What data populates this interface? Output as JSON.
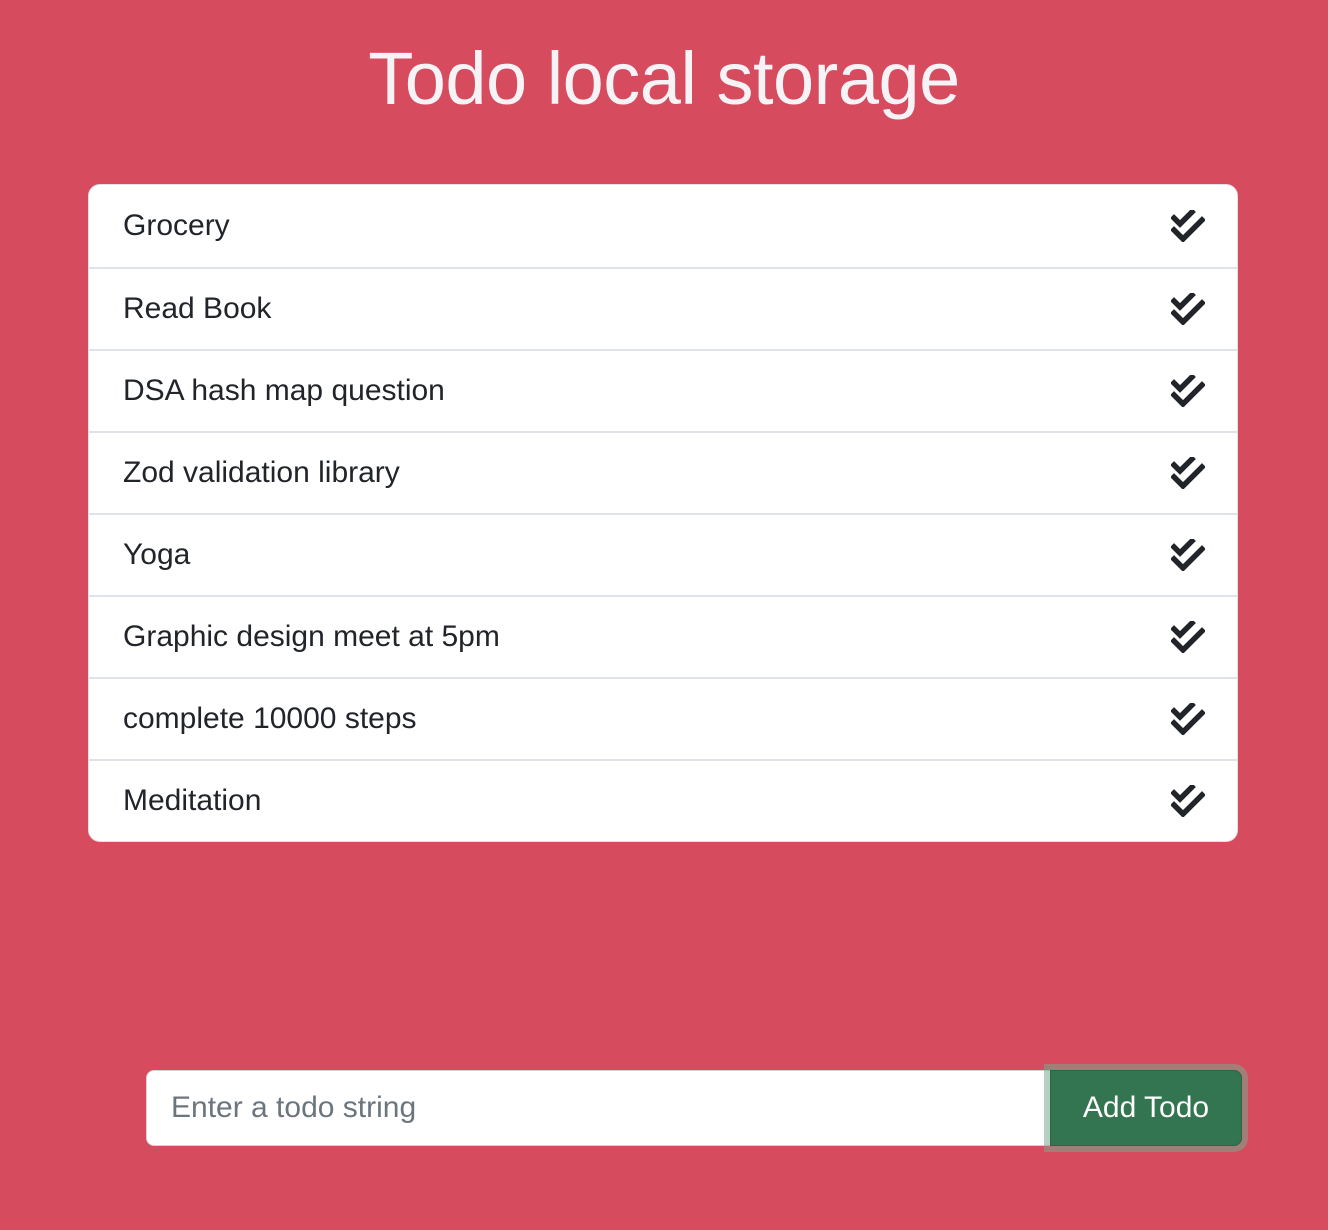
{
  "header": {
    "title": "Todo local storage"
  },
  "todos": [
    {
      "text": "Grocery",
      "icon": "double-check-icon"
    },
    {
      "text": "Read Book",
      "icon": "double-check-icon"
    },
    {
      "text": "DSA hash map question",
      "icon": "double-check-icon"
    },
    {
      "text": "Zod validation library",
      "icon": "double-check-icon"
    },
    {
      "text": "Yoga",
      "icon": "double-check-icon"
    },
    {
      "text": "Graphic design meet at 5pm",
      "icon": "double-check-icon"
    },
    {
      "text": "complete 10000 steps",
      "icon": "double-check-icon"
    },
    {
      "text": "Meditation",
      "icon": "double-check-icon"
    }
  ],
  "form": {
    "input_value": "",
    "input_placeholder": "Enter a todo string",
    "button_label": "Add Todo"
  },
  "colors": {
    "background": "#d64b5e",
    "button": "#347551",
    "title": "#f5f3f6"
  }
}
